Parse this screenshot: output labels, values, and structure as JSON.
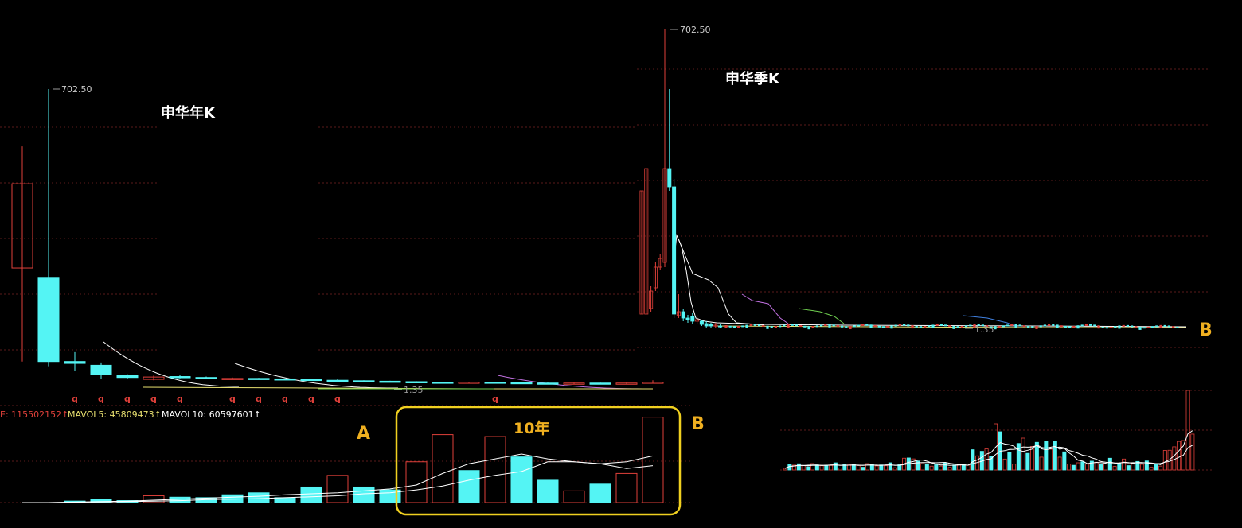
{
  "colors": {
    "background": "#000000",
    "up": "#e0403a",
    "down": "#54f4f4",
    "grid": "#5a1a1a",
    "ma_white": "#ffffff",
    "ma_yellow": "#e8e070",
    "ma_purple": "#c070e0",
    "ma_green": "#70d050",
    "ma_blue": "#4080e0",
    "highlight": "#f0d020",
    "title": "#ffffff",
    "annotation": "#f0b020"
  },
  "left_chart": {
    "title": "申华年K",
    "high_label": "702.50",
    "low_label": "1.35",
    "flag": "q",
    "volume_header": {
      "vol": "E: 115502152↑",
      "mavol5": "MAVOL5: 45809473↑",
      "mavol10": "MAVOL10: 60597601↑"
    }
  },
  "right_chart": {
    "title": "申华季K",
    "high_label": "702.50",
    "low_label": "1.35"
  },
  "annotations": {
    "a": "A",
    "b_left": "B",
    "b_right": "B",
    "ten_years": "10年"
  },
  "chart_data": [
    {
      "type": "candlestick",
      "title": "申华年K",
      "note": "yearly candles; price values approximate, high marker 702.50, low marker 1.35",
      "candles": [
        {
          "o": 320,
          "c": 500,
          "h": 580,
          "l": 120
        },
        {
          "o": 300,
          "c": 120,
          "h": 702.5,
          "l": 110
        },
        {
          "o": 120,
          "c": 116,
          "h": 140,
          "l": 100
        },
        {
          "o": 112,
          "c": 92,
          "h": 118,
          "l": 82
        },
        {
          "o": 90,
          "c": 86,
          "h": 93,
          "l": 83
        },
        {
          "o": 82,
          "c": 87,
          "h": 90,
          "l": 80
        },
        {
          "o": 88,
          "c": 86,
          "h": 92,
          "l": 84
        },
        {
          "o": 86,
          "c": 85,
          "h": 88,
          "l": 83
        },
        {
          "o": 84,
          "c": 84,
          "h": 86,
          "l": 82
        },
        {
          "o": 84,
          "c": 83,
          "h": 85,
          "l": 82
        },
        {
          "o": 83,
          "c": 82,
          "h": 84,
          "l": 81
        },
        {
          "o": 82,
          "c": 81,
          "h": 83,
          "l": 80
        },
        {
          "o": 80,
          "c": 79,
          "h": 82,
          "l": 78
        },
        {
          "o": 79,
          "c": 78,
          "h": 80,
          "l": 77
        },
        {
          "o": 78,
          "c": 77,
          "h": 79,
          "l": 76
        },
        {
          "o": 77,
          "c": 76,
          "h": 78,
          "l": 75
        },
        {
          "o": 76,
          "c": 75,
          "h": 77,
          "l": 74
        },
        {
          "o": 75,
          "c": 76,
          "h": 77,
          "l": 74
        },
        {
          "o": 76,
          "c": 75,
          "h": 77,
          "l": 74
        },
        {
          "o": 75,
          "c": 74,
          "h": 76,
          "l": 73
        },
        {
          "o": 74,
          "c": 73,
          "h": 75,
          "l": 72
        },
        {
          "o": 73,
          "c": 74,
          "h": 75,
          "l": 72
        },
        {
          "o": 74,
          "c": 73,
          "h": 75,
          "l": 72
        },
        {
          "o": 73,
          "c": 74,
          "h": 76,
          "l": 72
        },
        {
          "o": 74,
          "c": 76,
          "h": 80,
          "l": 73
        }
      ],
      "flags_at": [
        2,
        3,
        4,
        5,
        6,
        8,
        9,
        10,
        11,
        12,
        18
      ],
      "volume": {
        "ylim": [
          0,
          100
        ],
        "bars": [
          {
            "v": 0,
            "up": false
          },
          {
            "v": 0,
            "up": false
          },
          {
            "v": 1.5,
            "up": false
          },
          {
            "v": 3,
            "up": false
          },
          {
            "v": 2,
            "up": false
          },
          {
            "v": 7,
            "up": true
          },
          {
            "v": 5.5,
            "up": false
          },
          {
            "v": 5,
            "up": false
          },
          {
            "v": 8,
            "up": false
          },
          {
            "v": 10,
            "up": false
          },
          {
            "v": 5,
            "up": false
          },
          {
            "v": 16,
            "up": false
          },
          {
            "v": 28,
            "up": true
          },
          {
            "v": 16,
            "up": false
          },
          {
            "v": 13,
            "up": false
          },
          {
            "v": 42,
            "up": true
          },
          {
            "v": 70,
            "up": true
          },
          {
            "v": 33,
            "up": false
          },
          {
            "v": 68,
            "up": true
          },
          {
            "v": 47,
            "up": false
          },
          {
            "v": 23,
            "up": false
          },
          {
            "v": 12,
            "up": true
          },
          {
            "v": 19,
            "up": false
          },
          {
            "v": 30,
            "up": true
          },
          {
            "v": 88,
            "up": true
          }
        ],
        "mavol5": [
          0,
          0,
          0.5,
          1,
          1.5,
          2.5,
          3.5,
          4.5,
          5.5,
          6.5,
          8,
          9,
          10,
          12,
          14,
          18,
          30,
          40,
          45,
          50,
          45,
          42,
          40,
          35,
          38
        ],
        "mavol10": [
          0,
          0,
          0.3,
          0.6,
          1,
          1.5,
          2,
          3,
          3.5,
          4,
          5,
          6,
          7,
          9,
          10,
          13,
          17,
          23,
          28,
          32,
          42,
          42,
          40,
          42,
          48
        ]
      }
    },
    {
      "type": "candlestick",
      "title": "申华季K",
      "note": "quarterly candles; price values approximate, high marker 702.50, low marker 1.35",
      "volume": {
        "ylim": [
          0,
          100
        ]
      }
    }
  ]
}
